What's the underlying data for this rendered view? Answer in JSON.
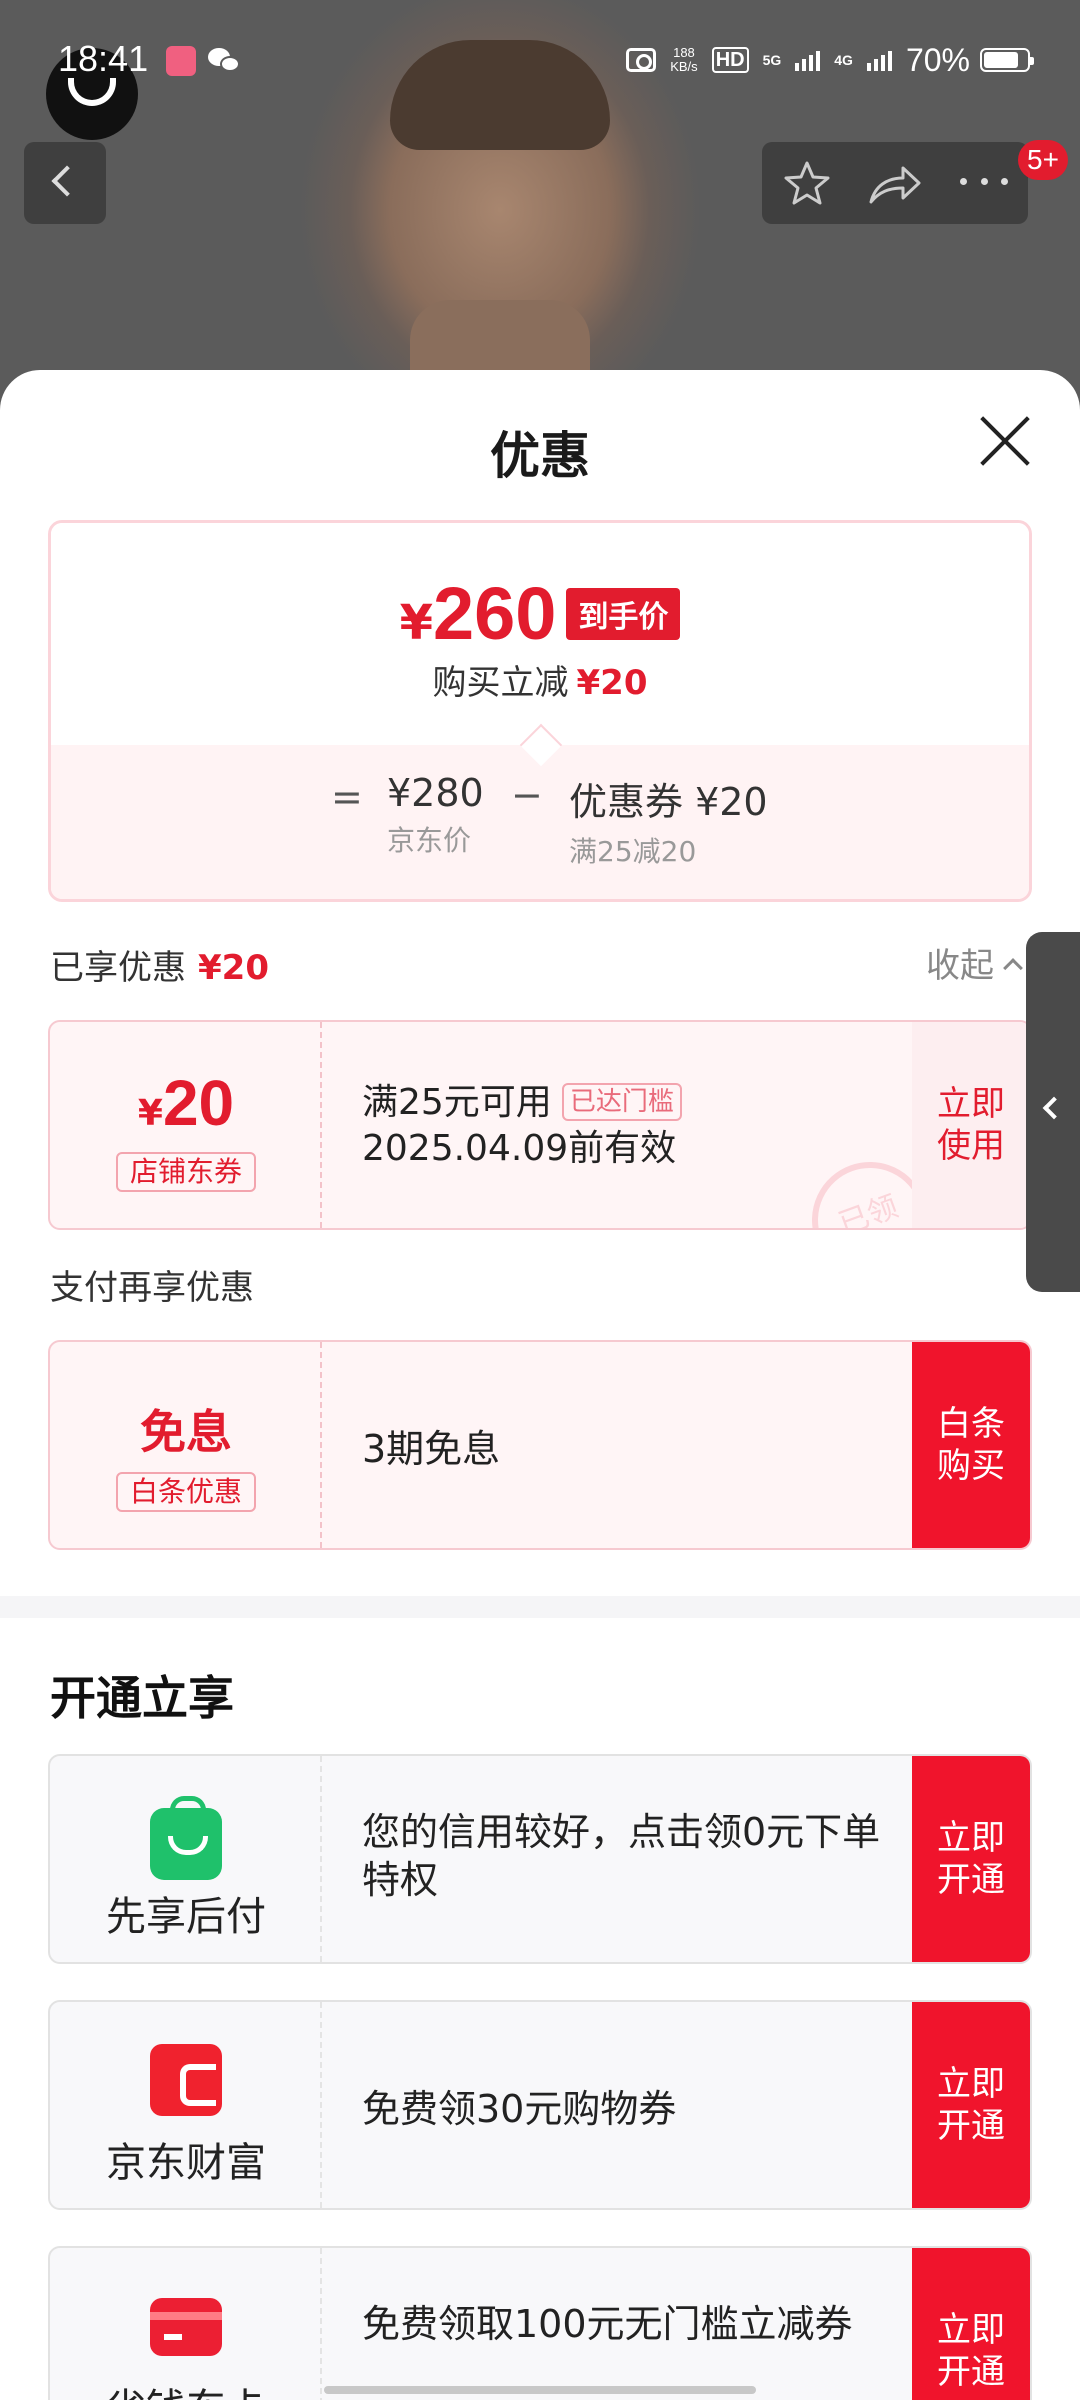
{
  "status_bar": {
    "time": "18:41",
    "net_speed": "188",
    "net_speed_unit": "KB/s",
    "hd_label": "HD",
    "net_5g": "5G",
    "net_4g": "4G",
    "battery_pct": "70%"
  },
  "nav": {
    "badge": "5+",
    "back_icon": "chevron-left-icon",
    "star_icon": "star-outline-icon",
    "share_icon": "share-arrow-icon",
    "more_icon": "more-dots-icon"
  },
  "sheet": {
    "title": "优惠"
  },
  "price_card": {
    "currency": "¥",
    "final_price": "260",
    "final_tag": "到手价",
    "discount_label": "购买立减",
    "discount_value": "¥20",
    "equals": "=",
    "original_price": "¥280",
    "original_label": "京东价",
    "minus": "−",
    "coupon_value": "优惠券 ¥20",
    "coupon_rule": "满25减20"
  },
  "enjoyed": {
    "label": "已享优惠",
    "value": "¥20",
    "collapse_label": "收起"
  },
  "store_coupon": {
    "currency": "¥",
    "amount": "20",
    "badge": "店铺东券",
    "condition": "满25元可用",
    "status_chip": "已达门槛",
    "validity": "2025.04.09前有效",
    "action": "立即使用",
    "stamp": "已领"
  },
  "pay_section": {
    "title": "支付再享优惠",
    "offer_big": "免息",
    "offer_badge": "白条优惠",
    "offer_text": "3期免息",
    "action": "白条购买"
  },
  "open_section": {
    "title": "开通立享",
    "items": [
      {
        "icon": "shopping-bag-icon",
        "name": "先享后付",
        "text": "您的信用较好，点击领0元下单特权",
        "action": "立即开通"
      },
      {
        "icon": "wallet-icon",
        "name": "京东财富",
        "text": "免费领30元购物券",
        "action": "立即开通"
      },
      {
        "icon": "card-icon",
        "name": "省钱东卡",
        "text": "免费领取100元无门槛立减券",
        "action": "立即开通"
      }
    ]
  },
  "colors": {
    "accent_red": "#e21c2e",
    "action_red": "#f0142c",
    "coupon_bg": "#fff5f6",
    "green": "#1fc16b"
  }
}
